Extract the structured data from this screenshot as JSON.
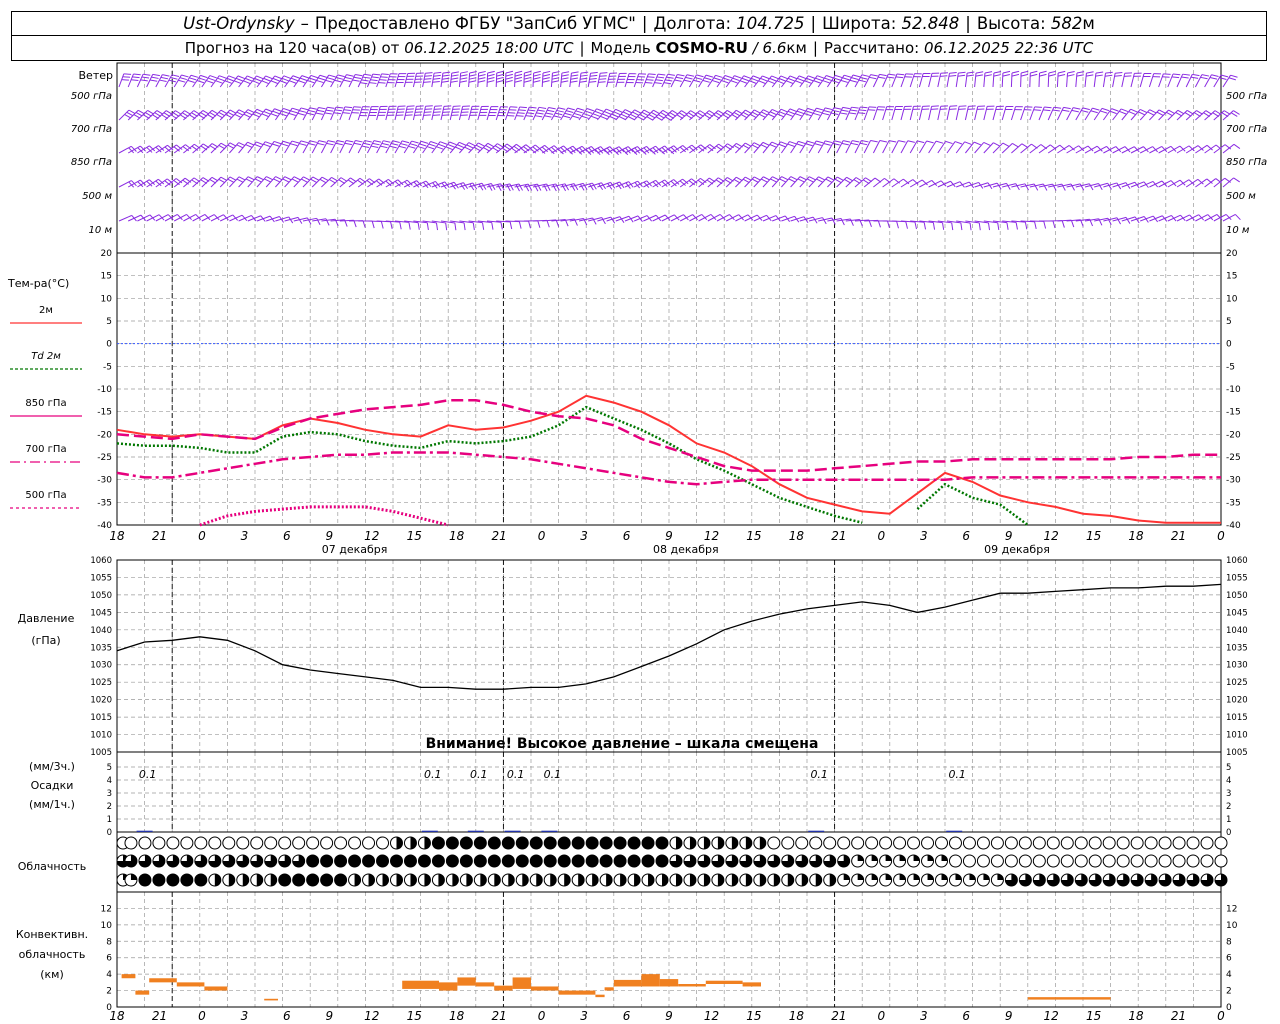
{
  "header": {
    "station": "Ust-Ordynsky",
    "dash": "–",
    "provider": "Предоставлено ФГБУ \"ЗапСиб УГМС\"",
    "lon_label": "Долгота:",
    "lon_value": "104.725",
    "lat_label": "Широта:",
    "lat_value": "52.848",
    "alt_label": "Высота:",
    "alt_value": "582",
    "alt_unit": "м",
    "forecast_label": "Прогноз на 120 часа(ов) от",
    "forecast_start": "06.12.2025 18:00 UTC",
    "model_label": "Модель",
    "model_name": "COSMO-RU",
    "model_res": "/ 6.6",
    "model_res_unit": "км",
    "calc_label": "Рассчитано:",
    "calc_time": "06.12.2025 22:36 UTC"
  },
  "wind_panel": {
    "title": "Ветер",
    "levels": [
      "500 гПа",
      "700 гПа",
      "850 гПа",
      "500 м",
      "10 м"
    ],
    "color": "#8a2be2"
  },
  "temp_panel": {
    "ylabel": "Тем-ра(°С)",
    "legend": [
      "2м",
      "Td 2м",
      "850 гПа",
      "700 гПа",
      "500 гПа"
    ]
  },
  "x_axis": {
    "hour_ticks": [
      "18",
      "21",
      "0",
      "3",
      "6",
      "9",
      "12",
      "15",
      "18",
      "21",
      "0",
      "3",
      "6",
      "9",
      "12",
      "15",
      "18",
      "21",
      "0",
      "3",
      "6",
      "9",
      "12",
      "15",
      "18",
      "21",
      "0"
    ],
    "dates": [
      "07 декабря",
      "08 декабря",
      "09 декабря"
    ]
  },
  "pressure_panel": {
    "ylabel_1": "Давление",
    "ylabel_2": "(гПа)",
    "warning": "Внимание! Высокое давление – шкала смещена"
  },
  "precip_panel": {
    "ylabel_1": "(мм/3ч.)",
    "ylabel_2": "Осадки",
    "ylabel_3": "(мм/1ч.)",
    "labels": [
      "0.1",
      "0.1",
      "0.1",
      "0.1",
      "0.1",
      "0.1",
      "0.1"
    ]
  },
  "cloud_panel": {
    "label": "Облачность"
  },
  "conv_panel": {
    "ylabel_1": "Конвективн.",
    "ylabel_2": "облачность",
    "ylabel_3": "(км)"
  },
  "colors": {
    "t2m": "#ff3333",
    "td2m": "#007700",
    "t850": "#e6007e",
    "t700": "#e6007e",
    "t500": "#e6007e",
    "zero_line": "#3355ff",
    "pressure": "#000000",
    "conv": "#f08020",
    "precip": "#2233aa"
  },
  "chart_data": [
    {
      "type": "line",
      "title": "Тем-ра(°С)",
      "x_hours": [
        0,
        3,
        6,
        9,
        12,
        15,
        18,
        21,
        24,
        27,
        30,
        33,
        36,
        39,
        42,
        45,
        48,
        51,
        54,
        57,
        60,
        63,
        66,
        69,
        72,
        75,
        78,
        81,
        84,
        87,
        90,
        93,
        96,
        99,
        102,
        105,
        108,
        111,
        114,
        117,
        120
      ],
      "ylim": [
        -40,
        20
      ],
      "yticks": [
        -40,
        -35,
        -30,
        -25,
        -20,
        -15,
        -10,
        -5,
        0,
        5,
        10,
        15,
        20
      ],
      "series": [
        {
          "name": "2м",
          "style": "solid",
          "values": [
            -19,
            -20,
            -20.5,
            -20,
            -20.5,
            -21,
            -18,
            -16.5,
            -17.5,
            -19,
            -20,
            -20.5,
            -18,
            -19,
            -18.5,
            -17,
            -15,
            -11.5,
            -13,
            -15,
            -18,
            -22,
            -24,
            -27,
            -31,
            -34,
            -35.5,
            -37,
            -37.5,
            -33,
            -28.5,
            -30.5,
            -33.5,
            -35,
            -36,
            -37.5,
            -38,
            -39,
            -39.5,
            -39.5,
            -39.5
          ]
        },
        {
          "name": "Td 2м",
          "style": "dotted",
          "values": [
            -22,
            -22.5,
            -22.5,
            -23,
            -24,
            -24,
            -20.5,
            -19.5,
            -20,
            -21.5,
            -22.5,
            -23,
            -21.5,
            -22,
            -21.5,
            -20.5,
            -18,
            -14,
            -16.5,
            -19,
            -22,
            -25.5,
            -28,
            -31,
            -34,
            -36,
            -38,
            -39.5,
            -41,
            -36.5,
            -31,
            -34,
            -35.5,
            -40,
            -41,
            -42,
            -43,
            -44,
            -44,
            -44,
            -44
          ]
        },
        {
          "name": "850 гПа",
          "style": "long-dash",
          "values": [
            -20,
            -20.5,
            -21,
            -20,
            -20.5,
            -21,
            -18.5,
            -16.5,
            -15.5,
            -14.5,
            -14,
            -13.5,
            -12.5,
            -12.5,
            -13.5,
            -15,
            -16,
            -16.5,
            -18,
            -21,
            -23,
            -25,
            -27,
            -28,
            -28,
            -28,
            -27.5,
            -27,
            -26.5,
            -26,
            -26,
            -25.5,
            -25.5,
            -25.5,
            -25.5,
            -25.5,
            -25.5,
            -25,
            -25,
            -24.5,
            -24.5
          ]
        },
        {
          "name": "700 гПа",
          "style": "dash-dot",
          "values": [
            -28.5,
            -29.5,
            -29.5,
            -28.5,
            -27.5,
            -26.5,
            -25.5,
            -25,
            -24.5,
            -24.5,
            -24,
            -24,
            -24,
            -24.5,
            -25,
            -25.5,
            -26.5,
            -27.5,
            -28.5,
            -29.5,
            -30.5,
            -31,
            -30.5,
            -30,
            -30,
            -30,
            -30,
            -30,
            -30,
            -30,
            -30,
            -29.5,
            -29.5,
            -29.5,
            -29.5,
            -29.5,
            -29.5,
            -29.5,
            -29.5,
            -29.5,
            -29.5
          ]
        },
        {
          "name": "500 гПа",
          "style": "dotted",
          "values": [
            null,
            null,
            null,
            -40,
            -38,
            -37,
            -36.5,
            -36,
            -36,
            -36,
            -37,
            -38.5,
            -40,
            null,
            null,
            null,
            null,
            null,
            null,
            null,
            null,
            null,
            null,
            null,
            null,
            null,
            null,
            null,
            null,
            null,
            null,
            null,
            null,
            null,
            null,
            null,
            null,
            null,
            null,
            null,
            null
          ]
        }
      ]
    },
    {
      "type": "line",
      "title": "Давление",
      "ylabel": "(гПа)",
      "ylim": [
        1005,
        1060
      ],
      "yticks": [
        1005,
        1010,
        1015,
        1020,
        1025,
        1030,
        1035,
        1040,
        1045,
        1050,
        1055,
        1060
      ],
      "x_hours": [
        0,
        3,
        6,
        9,
        12,
        15,
        18,
        21,
        24,
        27,
        30,
        33,
        36,
        39,
        42,
        45,
        48,
        51,
        54,
        57,
        60,
        63,
        66,
        69,
        72,
        75,
        78,
        81,
        84,
        87,
        90,
        93,
        96,
        99,
        102,
        105,
        108,
        111,
        114,
        117,
        120
      ],
      "values": [
        1034,
        1036.5,
        1037,
        1038,
        1037,
        1034,
        1030,
        1028.5,
        1027.5,
        1026.5,
        1025.5,
        1023.5,
        1023.5,
        1023,
        1023,
        1023.5,
        1023.5,
        1024.5,
        1026.5,
        1029.5,
        1032.5,
        1036,
        1040,
        1042.5,
        1044.5,
        1046,
        1047,
        1048,
        1047,
        1045,
        1046.5,
        1048.5,
        1050.5,
        1050.5,
        1051,
        1051.5,
        1052,
        1052,
        1052.5,
        1052.5,
        1053
      ]
    },
    {
      "type": "bar",
      "title": "Осадки",
      "ylim": [
        0,
        5
      ],
      "yticks": [
        0,
        1,
        2,
        3,
        4,
        5
      ],
      "x_hours": [
        3,
        34,
        39,
        43,
        47,
        76,
        91
      ],
      "values": [
        0.1,
        0.1,
        0.1,
        0.1,
        0.1,
        0.1,
        0.1
      ]
    },
    {
      "type": "bar",
      "title": "Конвективн. облачность (км)",
      "ylim": [
        0,
        14
      ],
      "yticks": [
        0,
        2,
        4,
        6,
        8,
        10,
        12
      ],
      "segments": [
        {
          "x0": 0.5,
          "x1": 2,
          "lo": 3.5,
          "hi": 4
        },
        {
          "x0": 2,
          "x1": 3.5,
          "lo": 1.5,
          "hi": 2
        },
        {
          "x0": 3.5,
          "x1": 6.5,
          "lo": 3,
          "hi": 3.5
        },
        {
          "x0": 6.5,
          "x1": 9.5,
          "lo": 2.5,
          "hi": 3
        },
        {
          "x0": 9.5,
          "x1": 12,
          "lo": 2,
          "hi": 2.5
        },
        {
          "x0": 16,
          "x1": 17.5,
          "lo": 0.8,
          "hi": 1
        },
        {
          "x0": 31,
          "x1": 35,
          "lo": 2.2,
          "hi": 3.2
        },
        {
          "x0": 35,
          "x1": 37,
          "lo": 2,
          "hi": 3
        },
        {
          "x0": 37,
          "x1": 39,
          "lo": 2.6,
          "hi": 3.6
        },
        {
          "x0": 39,
          "x1": 41,
          "lo": 2.5,
          "hi": 3
        },
        {
          "x0": 41,
          "x1": 43,
          "lo": 2,
          "hi": 2.6
        },
        {
          "x0": 43,
          "x1": 45,
          "lo": 2.2,
          "hi": 3.6
        },
        {
          "x0": 45,
          "x1": 48,
          "lo": 2,
          "hi": 2.5
        },
        {
          "x0": 48,
          "x1": 52,
          "lo": 1.5,
          "hi": 2
        },
        {
          "x0": 52,
          "x1": 53,
          "lo": 1.2,
          "hi": 1.5
        },
        {
          "x0": 53,
          "x1": 54,
          "lo": 2,
          "hi": 2.4
        },
        {
          "x0": 54,
          "x1": 57,
          "lo": 2.5,
          "hi": 3.3
        },
        {
          "x0": 57,
          "x1": 59,
          "lo": 2.5,
          "hi": 4
        },
        {
          "x0": 59,
          "x1": 61,
          "lo": 2.5,
          "hi": 3.4
        },
        {
          "x0": 61,
          "x1": 64,
          "lo": 2.5,
          "hi": 2.8
        },
        {
          "x0": 64,
          "x1": 68,
          "lo": 2.8,
          "hi": 3.2
        },
        {
          "x0": 68,
          "x1": 70,
          "lo": 2.5,
          "hi": 3
        },
        {
          "x0": 99,
          "x1": 108,
          "lo": 0.9,
          "hi": 1.2
        }
      ]
    }
  ]
}
